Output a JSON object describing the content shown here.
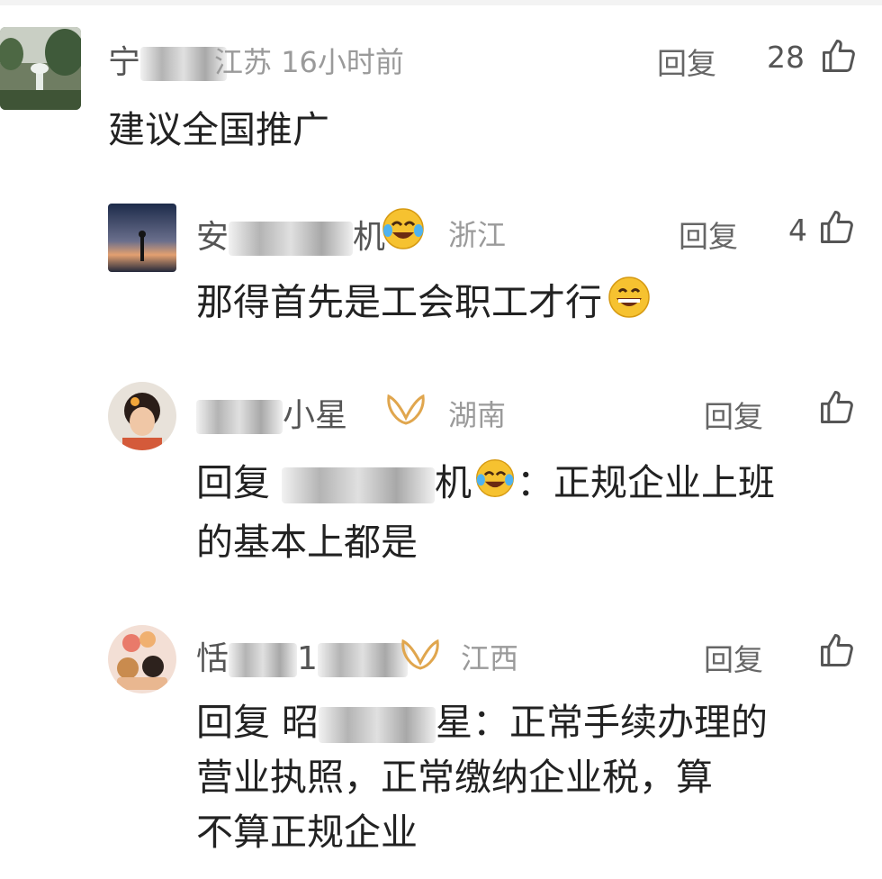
{
  "comments": [
    {
      "name_prefix": "宁",
      "name_suffix": "",
      "location": "江苏",
      "time": "16小时前",
      "reply_label": "回复",
      "likes": "28",
      "text": "建议全国推广"
    },
    {
      "name_prefix": "安",
      "name_suffix": "机",
      "location": "浙江",
      "reply_label": "回复",
      "likes": "4",
      "text": "那得首先是工会职工才行"
    },
    {
      "name_prefix": "",
      "name_suffix": "小星",
      "location": "湖南",
      "reply_label": "回复",
      "likes": "",
      "reply_prefix": "回复",
      "reply_to_end": "机",
      "text_line1": "：正规企业上班",
      "text_line2": "的基本上都是"
    },
    {
      "name_prefix": "恬",
      "name_suffix": "1",
      "location": "江西",
      "reply_label": "回复",
      "likes": "",
      "reply_prefix": "回复",
      "reply_to_start": "昭",
      "reply_to_end": "星",
      "text_line1": "：正常手续办理的",
      "text_line2": "营业执照，正常缴纳企业税，算",
      "text_line3": "不算正规企业"
    }
  ],
  "icons": {
    "like": "thumb-up-icon",
    "laugh_cry": "face-with-tears-of-joy-icon",
    "grin": "grinning-face-icon",
    "vip": "vip-badge-icon"
  }
}
